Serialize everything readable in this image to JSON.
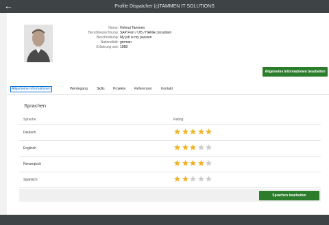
{
  "app": {
    "title": "Profile Dispatcher (c)TAMMEN IT SOLUTIONS"
  },
  "icons": {
    "back": "arrow-back-icon",
    "star": "star-icon"
  },
  "colors": {
    "accent": "#0a6ed1",
    "button": "#2b7d2b",
    "star_on": "#f0b429",
    "star_off": "#cccccc",
    "shell": "#3e4346"
  },
  "profile": {
    "attributes": [
      {
        "label": "Name:",
        "value": "Helmut Tammen"
      },
      {
        "label": "Berufsbezeichnung:",
        "value": "SAP Fiori / UI5 / HANA consultant"
      },
      {
        "label": "Beschreibung:",
        "value": "My job is my passion"
      },
      {
        "label": "Nationalität:",
        "value": "german"
      },
      {
        "label": "Erfahrung seit:",
        "value": "1988"
      }
    ],
    "edit_button": "Allgemeine Informationen bearbeiten"
  },
  "tabs": [
    {
      "label": "Allgemeine Informationen",
      "active": true
    },
    {
      "label": "Werdegang"
    },
    {
      "label": "Skills"
    },
    {
      "label": "Projekte"
    },
    {
      "label": "Referenzen"
    },
    {
      "label": "Kontakt"
    }
  ],
  "languages": {
    "title": "Sprachen",
    "columns": [
      "Sprache",
      "Rating"
    ],
    "rows": [
      {
        "language": "Deutsch",
        "rating": 5,
        "max": 5
      },
      {
        "language": "Englisch",
        "rating": 3,
        "max": 5
      },
      {
        "language": "Norwegisch",
        "rating": 4,
        "max": 5
      },
      {
        "language": "Spanisch",
        "rating": 2,
        "max": 5
      }
    ],
    "edit_button": "Sprachen bearbeiten"
  }
}
